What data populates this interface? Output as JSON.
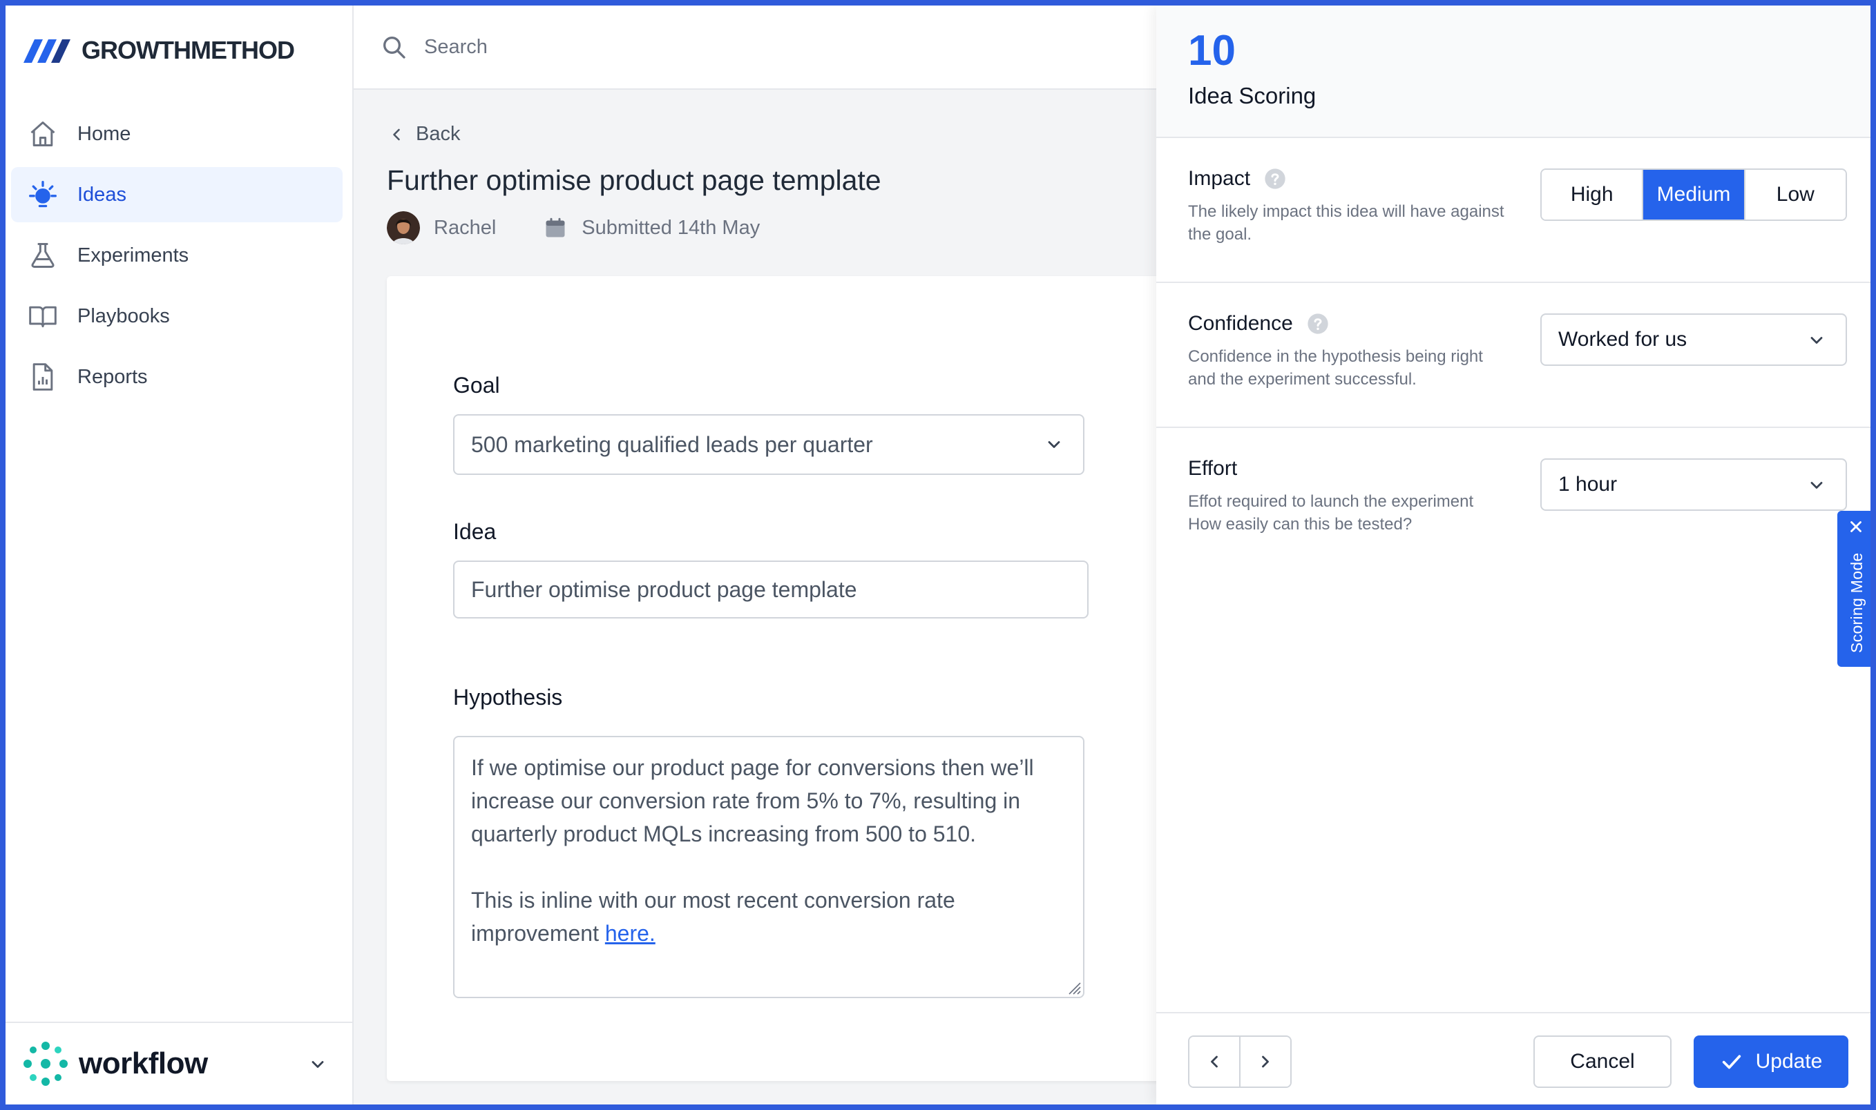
{
  "brand": {
    "name": "GROWTHMETHOD",
    "footer_name": "workflow"
  },
  "search": {
    "placeholder": "Search"
  },
  "nav": {
    "items": [
      {
        "label": "Home",
        "icon": "home-icon"
      },
      {
        "label": "Ideas",
        "icon": "lightbulb-icon",
        "active": true
      },
      {
        "label": "Experiments",
        "icon": "beaker-icon"
      },
      {
        "label": "Playbooks",
        "icon": "book-icon"
      },
      {
        "label": "Reports",
        "icon": "report-icon"
      }
    ]
  },
  "idea": {
    "back_label": "Back",
    "title": "Further optimise product page template",
    "author": "Rachel",
    "submitted": "Submitted 14th May"
  },
  "form": {
    "goal_label": "Goal",
    "goal_value": "500 marketing qualified leads per quarter",
    "idea_label": "Idea",
    "idea_value": "Further optimise product page template",
    "hypothesis_label": "Hypothesis",
    "hypothesis_p1": "If we optimise our product page for conversions then we’ll increase our conversion rate from 5% to 7%, resulting in quarterly product MQLs increasing from 500 to 510.",
    "hypothesis_p2_prefix": "This is inline with our most recent conversion rate improvement ",
    "hypothesis_link": "here."
  },
  "scoring": {
    "score": "10",
    "title": "Idea Scoring",
    "impact": {
      "label": "Impact",
      "description": "The likely impact this idea will have against the goal.",
      "options": [
        "High",
        "Medium",
        "Low"
      ],
      "selected": "Medium"
    },
    "confidence": {
      "label": "Confidence",
      "description": "Confidence in the hypothesis being right and the experiment successful.",
      "value": "Worked for us"
    },
    "effort": {
      "label": "Effort",
      "description_line1": "Effot required to launch the experiment",
      "description_line2": "How easily can this be tested?",
      "value": "1 hour"
    },
    "cancel_label": "Cancel",
    "update_label": "Update",
    "mode_label": "Scoring Mode"
  },
  "colors": {
    "accent": "#2563eb",
    "frame": "#2f5bdb",
    "active_nav_bg": "#eef4ff",
    "workflow_teal": "#14b8a6"
  }
}
